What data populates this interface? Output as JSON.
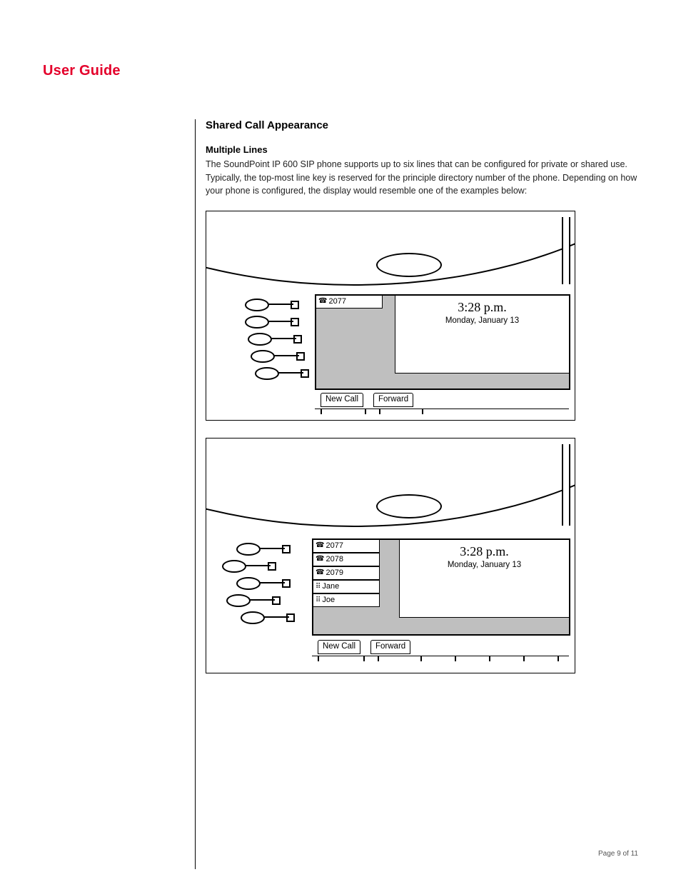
{
  "doc_title": "User Guide",
  "section_heading": "Shared Call Appearance",
  "subheading": "Multiple Lines",
  "body_paragraph": "The SoundPoint IP 600 SIP phone supports up to six lines that can be configured for private or shared use. Typically, the top-most line key is reserved for the principle directory number of the phone. Depending on how your phone is configured, the display would resemble one of the examples below:",
  "phone_a": {
    "time": "3:28 p.m.",
    "date": "Monday, January 13",
    "lines": [
      {
        "label": "2077",
        "icon": "phone"
      }
    ],
    "softkeys": [
      "New Call",
      "Forward"
    ]
  },
  "phone_b": {
    "time": "3:28 p.m.",
    "date": "Monday, January 13",
    "lines": [
      {
        "label": "2077",
        "icon": "phone"
      },
      {
        "label": "2078",
        "icon": "phone"
      },
      {
        "label": "2079",
        "icon": "phone"
      },
      {
        "label": "Jane",
        "icon": "dots"
      },
      {
        "label": "Joe",
        "icon": "dots"
      }
    ],
    "softkeys": [
      "New Call",
      "Forward"
    ]
  },
  "page_number": "Page 9 of 11"
}
